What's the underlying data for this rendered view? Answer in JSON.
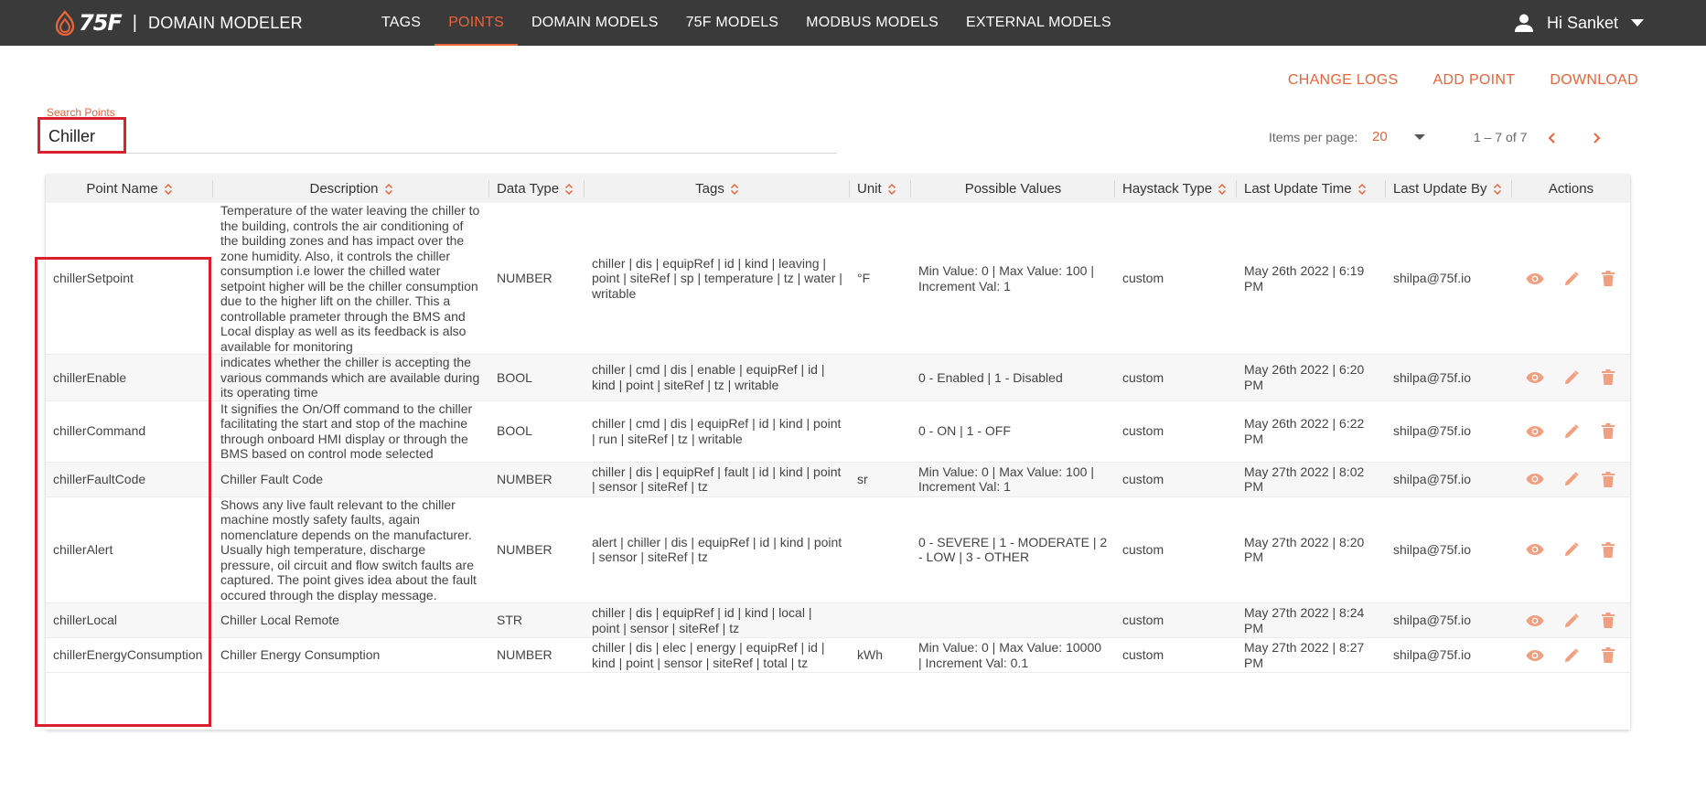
{
  "brand": {
    "logo_text": "75F",
    "separator": "|",
    "app_name": "DOMAIN MODELER"
  },
  "nav": {
    "items": [
      {
        "label": "TAGS",
        "active": false
      },
      {
        "label": "POINTS",
        "active": true
      },
      {
        "label": "DOMAIN MODELS",
        "active": false
      },
      {
        "label": "75F MODELS",
        "active": false
      },
      {
        "label": "MODBUS MODELS",
        "active": false
      },
      {
        "label": "EXTERNAL MODELS",
        "active": false
      }
    ]
  },
  "user": {
    "greeting": "Hi Sanket",
    "icon": "person-icon"
  },
  "toolbar": {
    "change_logs": "CHANGE LOGS",
    "add_point": "ADD POINT",
    "download": "DOWNLOAD"
  },
  "search": {
    "label": "Search Points",
    "value": "Chiller"
  },
  "paginator": {
    "items_per_page_label": "Items per page:",
    "items_per_page": "20",
    "range": "1 – 7 of 7"
  },
  "colors": {
    "accent": "#e8643a",
    "topbar": "#3a3a3a",
    "highlight": "#d9202c"
  },
  "table": {
    "columns": [
      {
        "label": "Point Name",
        "sortable": true
      },
      {
        "label": "Description",
        "sortable": true
      },
      {
        "label": "Data Type",
        "sortable": true
      },
      {
        "label": "Tags",
        "sortable": true
      },
      {
        "label": "Unit",
        "sortable": true
      },
      {
        "label": "Possible Values",
        "sortable": false
      },
      {
        "label": "Haystack Type",
        "sortable": true
      },
      {
        "label": "Last Update Time",
        "sortable": true
      },
      {
        "label": "Last Update By",
        "sortable": true
      },
      {
        "label": "Actions",
        "sortable": false
      }
    ],
    "rows": [
      {
        "name": "chillerSetpoint",
        "description": "Temperature of the water leaving the chiller to the building, controls the air conditioning of the building zones and has impact over the zone humidity. Also, it controls the chiller consumption i.e lower the chilled water setpoint higher will be the chiller consumption due to the higher lift on the chiller. This a controllable prameter through the BMS and Local display as well as its feedback is also available for monitoring",
        "data_type": "NUMBER",
        "tags": "chiller | dis | equipRef | id | kind | leaving | point | siteRef | sp | temperature | tz | water | writable",
        "unit": "°F",
        "possible_values": "Min Value: 0 | Max Value: 100 | Increment Val: 1",
        "haystack_type": "custom",
        "last_update_time": "May 26th 2022 | 6:19 PM",
        "last_update_by": "shilpa@75f.io"
      },
      {
        "name": "chillerEnable",
        "description": "indicates whether the chiller is accepting the various commands which are available during its operating time",
        "data_type": "BOOL",
        "tags": "chiller | cmd | dis | enable | equipRef | id | kind | point | siteRef | tz | writable",
        "unit": "",
        "possible_values": "0 - Enabled | 1 - Disabled",
        "haystack_type": "custom",
        "last_update_time": "May 26th 2022 | 6:20 PM",
        "last_update_by": "shilpa@75f.io"
      },
      {
        "name": "chillerCommand",
        "description": "It signifies the On/Off command to the chiller facilitating the start and stop of the machine through onboard HMI display or through the BMS based on control mode selected",
        "data_type": "BOOL",
        "tags": "chiller | cmd | dis | equipRef | id | kind | point | run | siteRef | tz | writable",
        "unit": "",
        "possible_values": "0 - ON | 1 - OFF",
        "haystack_type": "custom",
        "last_update_time": "May 26th 2022 | 6:22 PM",
        "last_update_by": "shilpa@75f.io"
      },
      {
        "name": "chillerFaultCode",
        "description": "Chiller Fault Code",
        "data_type": "NUMBER",
        "tags": "chiller | dis | equipRef | fault | id | kind | point | sensor | siteRef | tz",
        "unit": "sr",
        "possible_values": "Min Value: 0 | Max Value: 100 | Increment Val: 1",
        "haystack_type": "custom",
        "last_update_time": "May 27th 2022 | 8:02 PM",
        "last_update_by": "shilpa@75f.io"
      },
      {
        "name": "chillerAlert",
        "description": "Shows any live fault relevant to the chiller machine mostly safety faults, again nomenclature depends on the manufacturer. Usually high temperature, discharge pressure, oil circuit and flow switch faults are captured. The point gives idea about the fault occured through the display message.",
        "data_type": "NUMBER",
        "tags": "alert | chiller | dis | equipRef | id | kind | point | sensor | siteRef | tz",
        "unit": "",
        "possible_values": "0 - SEVERE | 1 - MODERATE | 2 - LOW | 3 - OTHER",
        "haystack_type": "custom",
        "last_update_time": "May 27th 2022 | 8:20 PM",
        "last_update_by": "shilpa@75f.io"
      },
      {
        "name": "chillerLocal",
        "description": "Chiller Local Remote",
        "data_type": "STR",
        "tags": "chiller | dis | equipRef | id | kind | local | point | sensor | siteRef | tz",
        "unit": "",
        "possible_values": "",
        "haystack_type": "custom",
        "last_update_time": "May 27th 2022 | 8:24 PM",
        "last_update_by": "shilpa@75f.io"
      },
      {
        "name": "chillerEnergyConsumption",
        "description": "Chiller Energy Consumption",
        "data_type": "NUMBER",
        "tags": "chiller | dis | elec | energy | equipRef | id | kind | point | sensor | siteRef | total | tz",
        "unit": "kWh",
        "possible_values": "Min Value: 0 | Max Value: 10000 | Increment Val: 0.1",
        "haystack_type": "custom",
        "last_update_time": "May 27th 2022 | 8:27 PM",
        "last_update_by": "shilpa@75f.io"
      }
    ],
    "row_actions": [
      "view-icon",
      "edit-icon",
      "delete-icon"
    ]
  }
}
